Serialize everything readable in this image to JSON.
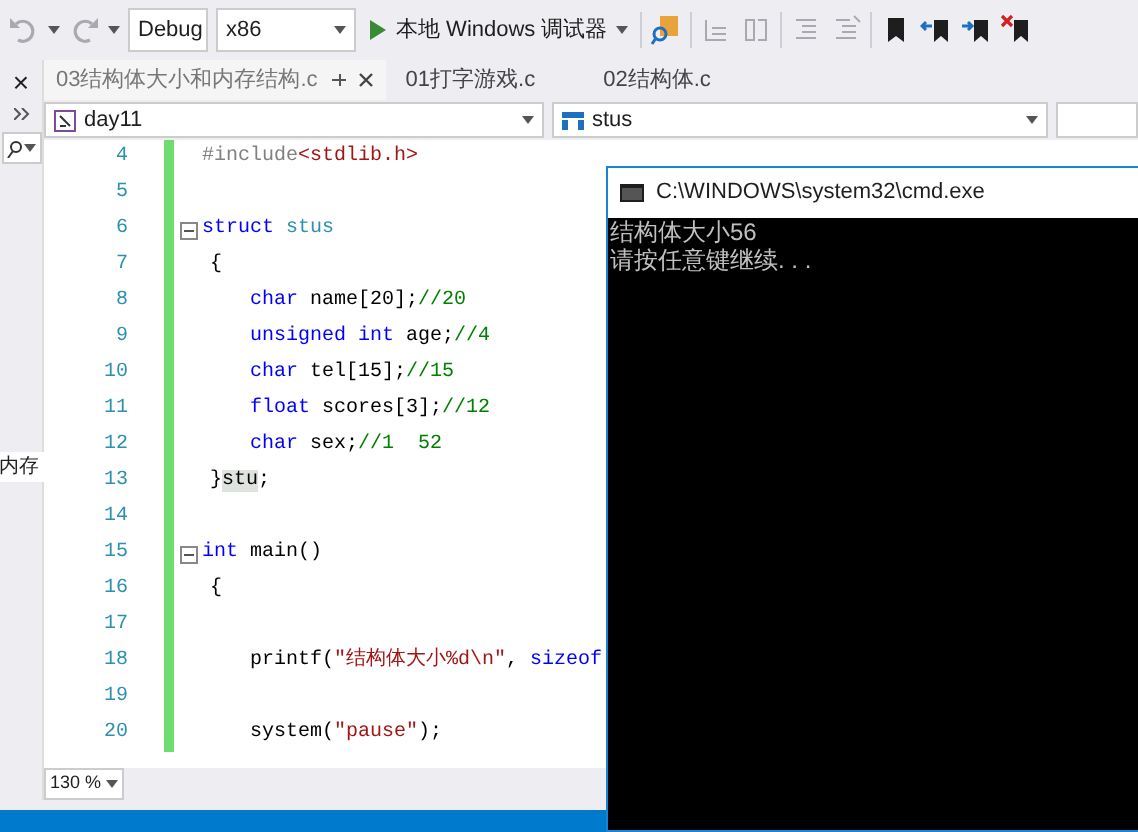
{
  "toolbar": [
    {
      "kind": "undo",
      "disabled": true
    },
    {
      "kind": "redo",
      "disabled": true
    },
    {
      "kind": "select",
      "value": "Debug"
    },
    {
      "kind": "select",
      "value": "x86"
    },
    {
      "kind": "run",
      "label": "本地 Windows 调试器"
    },
    {
      "kind": "find",
      "disabled": false
    },
    {
      "kind": "indent",
      "disabled": true
    },
    {
      "kind": "outdent",
      "disabled": true
    },
    {
      "kind": "comment",
      "disabled": true
    },
    {
      "kind": "uncomment",
      "disabled": true
    },
    {
      "kind": "bookmark",
      "disabled": false
    },
    {
      "kind": "bookmark-prev",
      "disabled": false
    },
    {
      "kind": "bookmark-next",
      "disabled": false
    },
    {
      "kind": "bookmark-clear",
      "disabled": false
    }
  ],
  "side_panel": {
    "close": "×",
    "tree_item": "内存"
  },
  "tabs": [
    {
      "label": "03结构体大小和内存结构.c",
      "selected": true
    },
    {
      "label": "01打字游戏.c",
      "selected": false
    },
    {
      "label": "02结构体.c",
      "selected": false
    }
  ],
  "nav_bar": {
    "project": "day11",
    "scope": "stus"
  },
  "editor": {
    "lines": [
      {
        "number": "4",
        "kind": "top",
        "segments": [
          {
            "text": "#include",
            "kind": "preprocessor"
          },
          {
            "text": "<stdlib.h>",
            "kind": "string"
          }
        ]
      },
      {
        "number": "5",
        "kind": "top"
      },
      {
        "number": "6",
        "kind": "top",
        "foldable": true,
        "segments": [
          {
            "text": "struct",
            "kind": "keyword"
          },
          {
            "text": " stus",
            "kind": "typename"
          }
        ]
      },
      {
        "number": "7",
        "kind": "brace",
        "segments": [
          {
            "text": "{",
            "kind": "plain"
          }
        ]
      },
      {
        "number": "8",
        "kind": "body",
        "segments": [
          {
            "text": "char",
            "kind": "keyword"
          },
          {
            "text": " name[20];",
            "kind": "plain"
          },
          {
            "text": "//20",
            "kind": "comment"
          }
        ]
      },
      {
        "number": "9",
        "kind": "body",
        "segments": [
          {
            "text": "unsigned int",
            "kind": "keyword"
          },
          {
            "text": " age;",
            "kind": "plain"
          },
          {
            "text": "//4",
            "kind": "comment"
          }
        ]
      },
      {
        "number": "10",
        "kind": "body",
        "segments": [
          {
            "text": "char",
            "kind": "keyword"
          },
          {
            "text": " tel[15];",
            "kind": "plain"
          },
          {
            "text": "//15",
            "kind": "comment"
          }
        ]
      },
      {
        "number": "11",
        "kind": "body",
        "segments": [
          {
            "text": "float",
            "kind": "keyword"
          },
          {
            "text": " scores[3];",
            "kind": "plain"
          },
          {
            "text": "//12",
            "kind": "comment"
          }
        ]
      },
      {
        "number": "12",
        "kind": "body",
        "segments": [
          {
            "text": "char",
            "kind": "keyword"
          },
          {
            "text": " sex;",
            "kind": "plain"
          },
          {
            "text": "//1  52",
            "kind": "comment"
          }
        ]
      },
      {
        "number": "13",
        "kind": "brace",
        "segments": [
          {
            "text": "}",
            "kind": "plain"
          },
          {
            "text": "stu",
            "kind": "plain",
            "highlighted": true
          },
          {
            "text": ";",
            "kind": "plain"
          }
        ]
      },
      {
        "number": "14",
        "kind": "top"
      },
      {
        "number": "15",
        "kind": "top",
        "foldable": true,
        "segments": [
          {
            "text": "int",
            "kind": "keyword"
          },
          {
            "text": " main()",
            "kind": "plain"
          }
        ]
      },
      {
        "number": "16",
        "kind": "brace",
        "segments": [
          {
            "text": "{",
            "kind": "plain"
          }
        ]
      },
      {
        "number": "17",
        "kind": "body"
      },
      {
        "number": "18",
        "kind": "body",
        "segments": [
          {
            "text": "printf(",
            "kind": "plain"
          },
          {
            "text": "\"结构体大小%d\\n\"",
            "kind": "string"
          },
          {
            "text": ", ",
            "kind": "plain"
          },
          {
            "text": "sizeof",
            "kind": "keyword"
          }
        ]
      },
      {
        "number": "19",
        "kind": "body"
      },
      {
        "number": "20",
        "kind": "body",
        "segments": [
          {
            "text": "system(",
            "kind": "plain"
          },
          {
            "text": "\"pause\"",
            "kind": "string"
          },
          {
            "text": ");",
            "kind": "plain"
          }
        ]
      }
    ]
  },
  "zoom": "130 %",
  "console": {
    "title": "C:\\WINDOWS\\system32\\cmd.exe",
    "lines": [
      "结构体大小56",
      "请按任意键继续. . ."
    ]
  }
}
